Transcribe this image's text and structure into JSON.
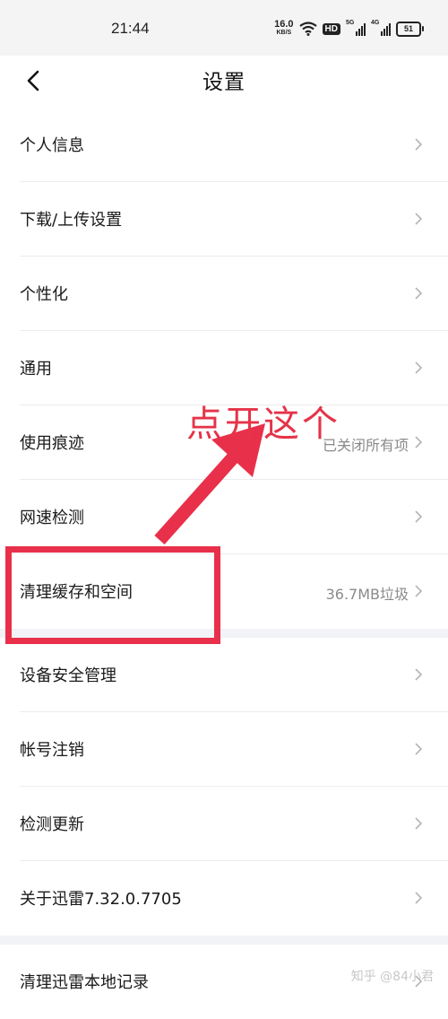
{
  "status_bar": {
    "time": "21:44",
    "net_speed": "16.0",
    "net_speed_unit": "KB/S",
    "hd_badge": "HD",
    "signal_1": "5G",
    "signal_2": "4G",
    "battery": "51"
  },
  "header": {
    "title": "设置",
    "back_icon": "chevron-left-icon"
  },
  "settings": {
    "group1": [
      {
        "label": "个人信息",
        "value": ""
      },
      {
        "label": "下载/上传设置",
        "value": ""
      },
      {
        "label": "个性化",
        "value": ""
      },
      {
        "label": "通用",
        "value": ""
      },
      {
        "label": "使用痕迹",
        "value": "已关闭所有项"
      },
      {
        "label": "网速检测",
        "value": ""
      },
      {
        "label": "清理缓存和空间",
        "value": "36.7MB垃圾"
      }
    ],
    "group2": [
      {
        "label": "设备安全管理",
        "value": ""
      },
      {
        "label": "帐号注销",
        "value": ""
      },
      {
        "label": "检测更新",
        "value": ""
      },
      {
        "label": "关于迅雷7.32.0.7705",
        "value": ""
      }
    ],
    "group3": [
      {
        "label": "清理迅雷本地记录",
        "value": ""
      }
    ]
  },
  "annotation": {
    "text": "点开这个",
    "color": "#e8304a"
  },
  "watermark": "知乎 @84小君"
}
